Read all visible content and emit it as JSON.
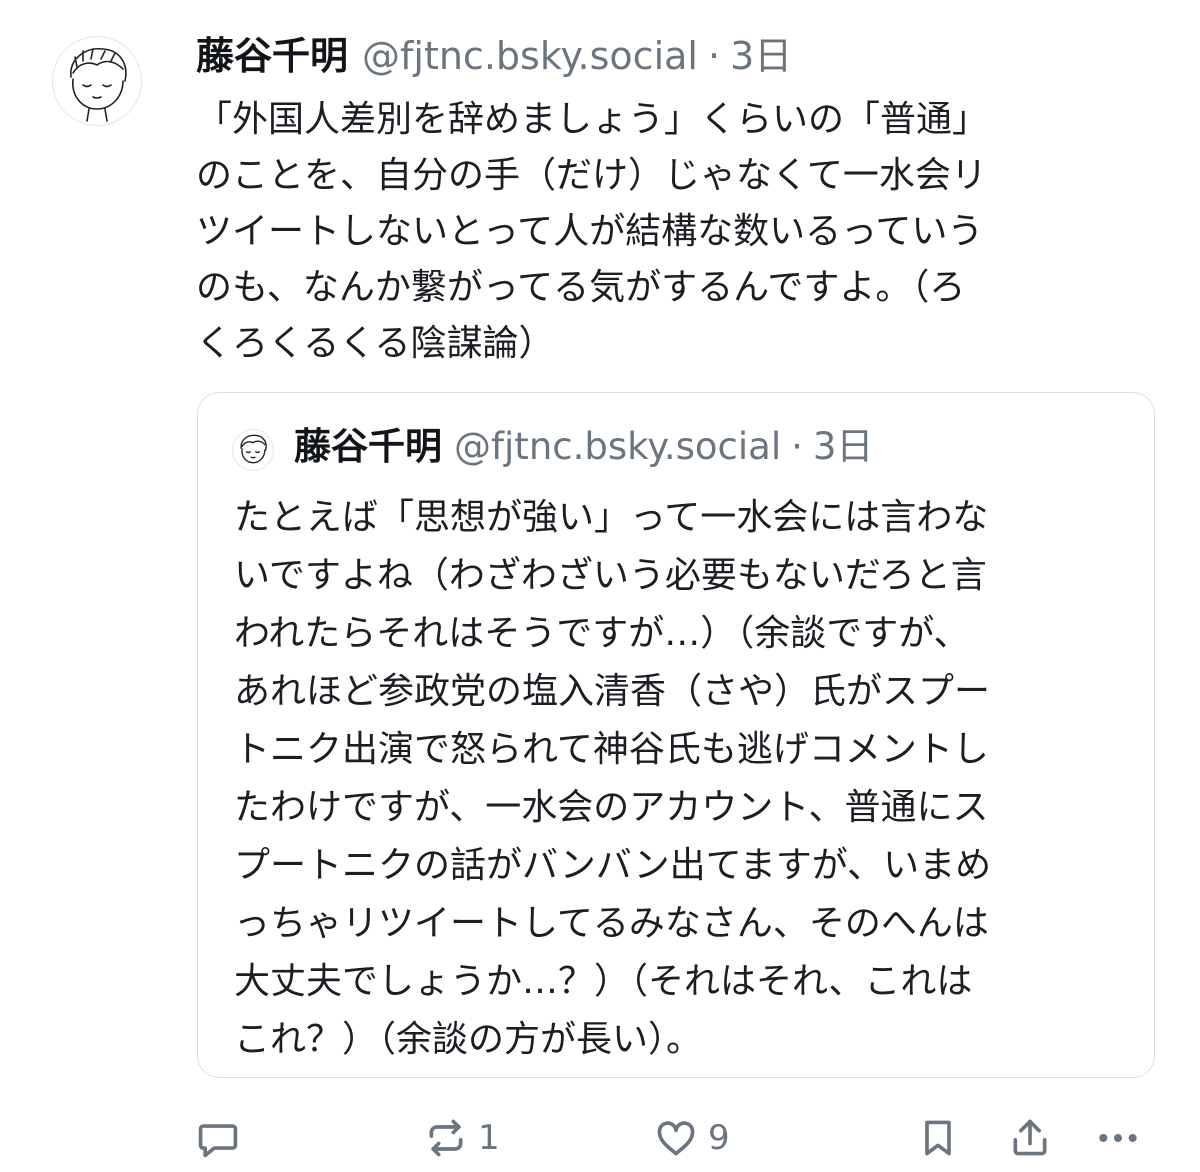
{
  "post": {
    "author_name": "藤谷千明",
    "handle": "@fjtnc.bsky.social",
    "separator": "·",
    "timestamp": "3日",
    "text_lines": [
      "「外国人差別を辞めましょう」くらいの「普通」",
      "のことを、自分の手（だけ）じゃなくて一水会リ",
      "ツイートしないとって人が結構な数いるっていう",
      "のも、なんか繋がってる気がするんですよ。（ろ",
      "くろくるくる陰謀論）"
    ]
  },
  "quote": {
    "author_name": "藤谷千明",
    "handle": "@fjtnc.bsky.social",
    "separator": "·",
    "timestamp": "3日",
    "text_lines": [
      "たとえば「思想が強い」って一水会には言わな",
      "いですよね（わざわざいう必要もないだろと言",
      "われたらそれはそうですが…）（余談ですが、",
      "あれほど参政党の塩入清香（さや）氏がスプー",
      "トニク出演で怒られて神谷氏も逃げコメントし",
      "たわけですが、一水会のアカウント、普通にス",
      "プートニクの話がバンバン出てますが、いまめ",
      "っちゃリツイートしてるみなさん、そのへんは",
      "大丈夫でしょうか…？）（それはそれ、これは",
      "これ？）（余談の方が長い）。"
    ]
  },
  "actions": {
    "reply": {
      "icon": "reply-icon"
    },
    "repost": {
      "icon": "repost-icon",
      "count": "1"
    },
    "like": {
      "icon": "heart-icon",
      "count": "9"
    },
    "bookmark": {
      "icon": "bookmark-icon"
    },
    "share": {
      "icon": "share-icon"
    },
    "more": {
      "icon": "more-icon"
    }
  },
  "colors": {
    "text": "#1b1f24",
    "muted": "#6b7580",
    "border": "#d9dde2",
    "background": "#ffffff"
  }
}
